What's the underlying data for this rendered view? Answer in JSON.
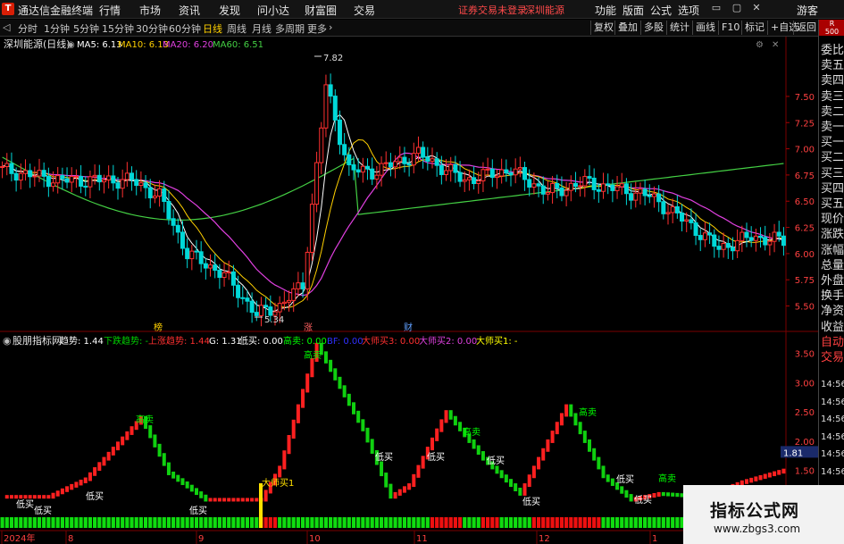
{
  "app": {
    "name": "通达信金融终端",
    "menu": [
      "行情",
      "市场",
      "资讯",
      "发现",
      "问小达",
      "财富圈",
      "交易"
    ],
    "warning": "证券交易未登录",
    "stock_link": "深圳能源",
    "right_menu": [
      "功能",
      "版面",
      "公式",
      "选项"
    ],
    "guest": "游客"
  },
  "toolbar": {
    "periods": [
      "分时",
      "1分钟",
      "5分钟",
      "15分钟",
      "30分钟",
      "60分钟",
      "日线",
      "周线",
      "月线",
      "多周期",
      "更多"
    ],
    "active_period": "日线",
    "buttons": [
      "复权",
      "叠加",
      "多股",
      "统计",
      "画线",
      "F10",
      "标记",
      "+自选",
      "返回"
    ]
  },
  "main_chart": {
    "stock": "深圳能源(日线)",
    "ma": [
      {
        "label": "MA5: 6.13",
        "color": "#ffffff"
      },
      {
        "label": "MA10: 6.13",
        "color": "#ffd000"
      },
      {
        "label": "MA20: 6.20",
        "color": "#e040e0"
      },
      {
        "label": "MA60: 6.51",
        "color": "#44d044"
      }
    ],
    "y_ticks": [
      "7.50",
      "7.25",
      "7.00",
      "6.75",
      "6.50",
      "6.25",
      "6.00",
      "5.75",
      "5.50"
    ],
    "high_label": "7.82",
    "low_label": "5.34",
    "markers": [
      "榜",
      "涨",
      "财"
    ]
  },
  "indicator": {
    "name": "股朋指标网",
    "items": [
      {
        "label": "趋势: 1.44",
        "color": "#ffffff"
      },
      {
        "label": "下跌趋势: -",
        "color": "#00d000"
      },
      {
        "label": "上涨趋势: 1.44",
        "color": "#ff3030"
      },
      {
        "label": "G: 1.31",
        "color": "#ffffff"
      },
      {
        "label": "低买: 0.00",
        "color": "#ffffff"
      },
      {
        "label": "高卖: 0.00",
        "color": "#00ff00"
      },
      {
        "label": "BF: 0.00",
        "color": "#3030ff"
      },
      {
        "label": "大师买3: 0.00",
        "color": "#ff3030"
      },
      {
        "label": "大师买2: 0.00",
        "color": "#e040e0"
      },
      {
        "label": "大师买1: -",
        "color": "#ffff00"
      }
    ],
    "y_ticks": [
      "3.50",
      "3.00",
      "2.50",
      "2.00",
      "1.50",
      "1.00"
    ],
    "current": "1.81",
    "signals": [
      "高卖",
      "低买",
      "大师买1"
    ]
  },
  "x_axis": [
    "2024年",
    "8",
    "9",
    "10",
    "11",
    "12",
    "1"
  ],
  "right_panel": {
    "badge": "R\n500",
    "items": [
      "委比",
      "卖五",
      "卖四",
      "卖三",
      "卖二",
      "卖一",
      "买一",
      "买二",
      "买三",
      "买四",
      "买五",
      "现价",
      "涨跌",
      "涨幅",
      "总量",
      "外盘",
      "换手",
      "净资",
      "收益",
      "自动",
      "交易"
    ],
    "times": [
      "14:56",
      "14:56",
      "14:56",
      "14:56",
      "14:56",
      "14:56",
      "14:56"
    ]
  },
  "watermark": {
    "title": "指标公式网",
    "url": "www.zbgs3.com"
  },
  "colors": {
    "up": "#ff3030",
    "down": "#00d8d8",
    "ma5": "#ffffff",
    "ma10": "#ffd000",
    "ma20": "#e040e0",
    "ma60": "#44d044"
  }
}
